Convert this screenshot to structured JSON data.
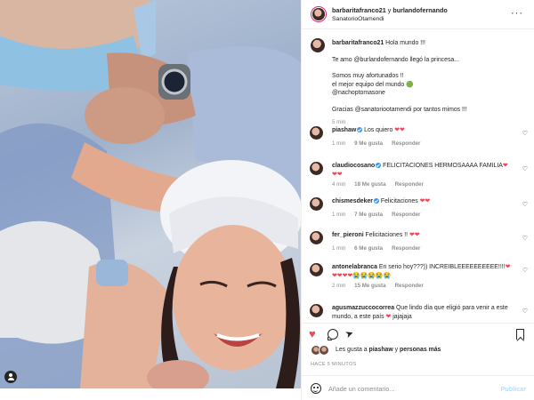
{
  "photo": {
    "alt": "",
    "tag_icon": "user-tag-icon"
  },
  "header": {
    "user1": "barbaritafranco21",
    "and": " y ",
    "user2": "burlandofernando",
    "location": "SanatorioOtamendi",
    "more": "···"
  },
  "caption": {
    "user": "barbaritafranco21",
    "lines": [
      "Hola mundo !!!",
      "Te amo @burlandofernando llegó la princesa...",
      "Somos muy afortunados !!",
      "el mejor equipo del mundo 🟢",
      "@nachoptomasone",
      "Gracias @sanatoriootamendi por tantos mimos !!!"
    ],
    "time": "5 min"
  },
  "comments": [
    {
      "user": "piashaw",
      "verified": true,
      "text": "Los quiero ❤❤",
      "time": "1 min",
      "likes": "9 Me gusta",
      "reply": "Responder"
    },
    {
      "user": "claudiocosano",
      "verified": true,
      "text": "FELICITACIONES HERMOSAAAA FAMILIA❤",
      "text2": "❤❤",
      "time": "4 min",
      "likes": "18 Me gusta",
      "reply": "Responder"
    },
    {
      "user": "chismesdeker",
      "verified": true,
      "text": "Felicitaciones ❤❤",
      "time": "1 min",
      "likes": "7 Me gusta",
      "reply": "Responder"
    },
    {
      "user": "fer_pieroni",
      "verified": false,
      "text": "Felicitaciones !! ❤❤",
      "time": "1 min",
      "likes": "6 Me gusta",
      "reply": "Responder"
    },
    {
      "user": "antonelabranca",
      "verified": false,
      "text": "En serio hoy???)) INCREIBLEEEEEEEEEE!!!!❤",
      "text2": "❤❤❤❤😭😭😭😭😭",
      "time": "2 min",
      "likes": "15 Me gusta",
      "reply": "Responder"
    },
    {
      "user": "agusmazzuccocorrea",
      "verified": false,
      "text": "Que lindo día que eligió para venir a este",
      "text2": "mundo, a este país ❤ jajajaja",
      "time": "",
      "likes": "",
      "reply": ""
    }
  ],
  "likes_summary": {
    "prefix": "Les gusta a ",
    "user": "piashaw",
    "middle": " y ",
    "others": "personas más"
  },
  "time_ago": "HACE 5 MINUTOS",
  "add_comment": {
    "placeholder": "Añade un comentario...",
    "post": "Publicar"
  },
  "colors": {
    "like_red": "#ed4956",
    "link_blue": "#00376b",
    "verified_blue": "#3897f0",
    "post_disabled": "#b2dffc"
  }
}
